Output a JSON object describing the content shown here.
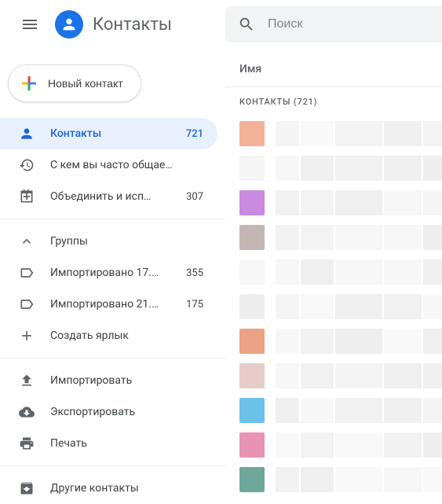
{
  "app_title": "Контакты",
  "new_contact_label": "Новый контакт",
  "search": {
    "placeholder": "Поиск"
  },
  "column_header": "Имя",
  "section_header": "КОНТАКТЫ (721)",
  "sidebar": {
    "main": [
      {
        "icon": "person",
        "label": "Контакты",
        "count": "721",
        "active": true
      },
      {
        "icon": "history",
        "label": "С кем вы часто общае…",
        "count": ""
      },
      {
        "icon": "merge",
        "label": "Объединить и исп…",
        "count": "307"
      }
    ],
    "groups_header": {
      "icon": "chevron-up",
      "label": "Группы"
    },
    "groups": [
      {
        "icon": "label",
        "label": "Импортировано 17.…",
        "count": "355"
      },
      {
        "icon": "label",
        "label": "Импортировано 21.…",
        "count": "175"
      },
      {
        "icon": "plus",
        "label": "Создать ярлык",
        "count": ""
      }
    ],
    "io": [
      {
        "icon": "upload",
        "label": "Импортировать"
      },
      {
        "icon": "download-cloud",
        "label": "Экспортировать"
      },
      {
        "icon": "print",
        "label": "Печать"
      }
    ],
    "other": [
      {
        "icon": "archive",
        "label": "Другие контакты"
      }
    ]
  },
  "contacts": [
    {
      "color": "#f4b19a"
    },
    {
      "color": "#f5f5f5"
    },
    {
      "color": "#c98adf"
    },
    {
      "color": "#c4b7b3"
    },
    {
      "color": "#f7f7f7"
    },
    {
      "color": "#ededed"
    },
    {
      "color": "#eba284"
    },
    {
      "color": "#e7cdca"
    },
    {
      "color": "#6cc1ea"
    },
    {
      "color": "#e893b4"
    },
    {
      "color": "#6fa89a"
    }
  ]
}
